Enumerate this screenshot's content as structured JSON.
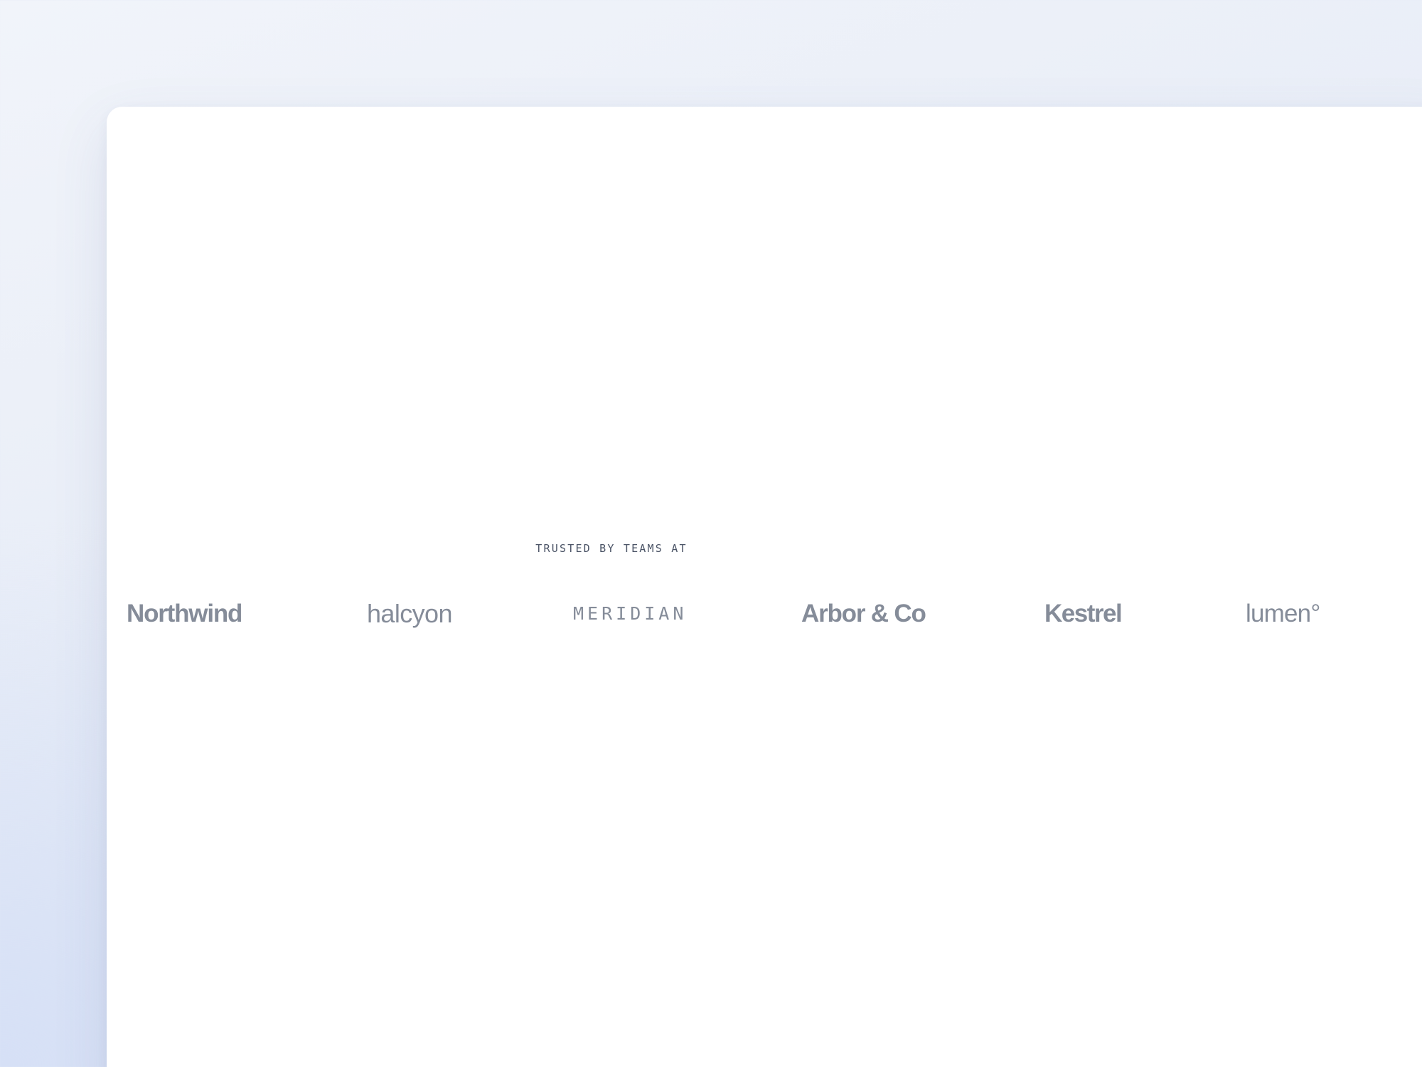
{
  "trusted_section": {
    "eyebrow": "TRUSTED BY TEAMS AT",
    "logos": [
      {
        "name": "Northwind"
      },
      {
        "name": "halcyon"
      },
      {
        "name": "MERIDIAN"
      },
      {
        "name": "Arbor & Co"
      },
      {
        "name": "Kestrel"
      },
      {
        "name": "lumen°"
      }
    ]
  },
  "colors": {
    "logo_gray": "#858c99",
    "eyebrow_text": "#4b5466",
    "card_background": "#ffffff",
    "page_background": "#e8edf7"
  }
}
